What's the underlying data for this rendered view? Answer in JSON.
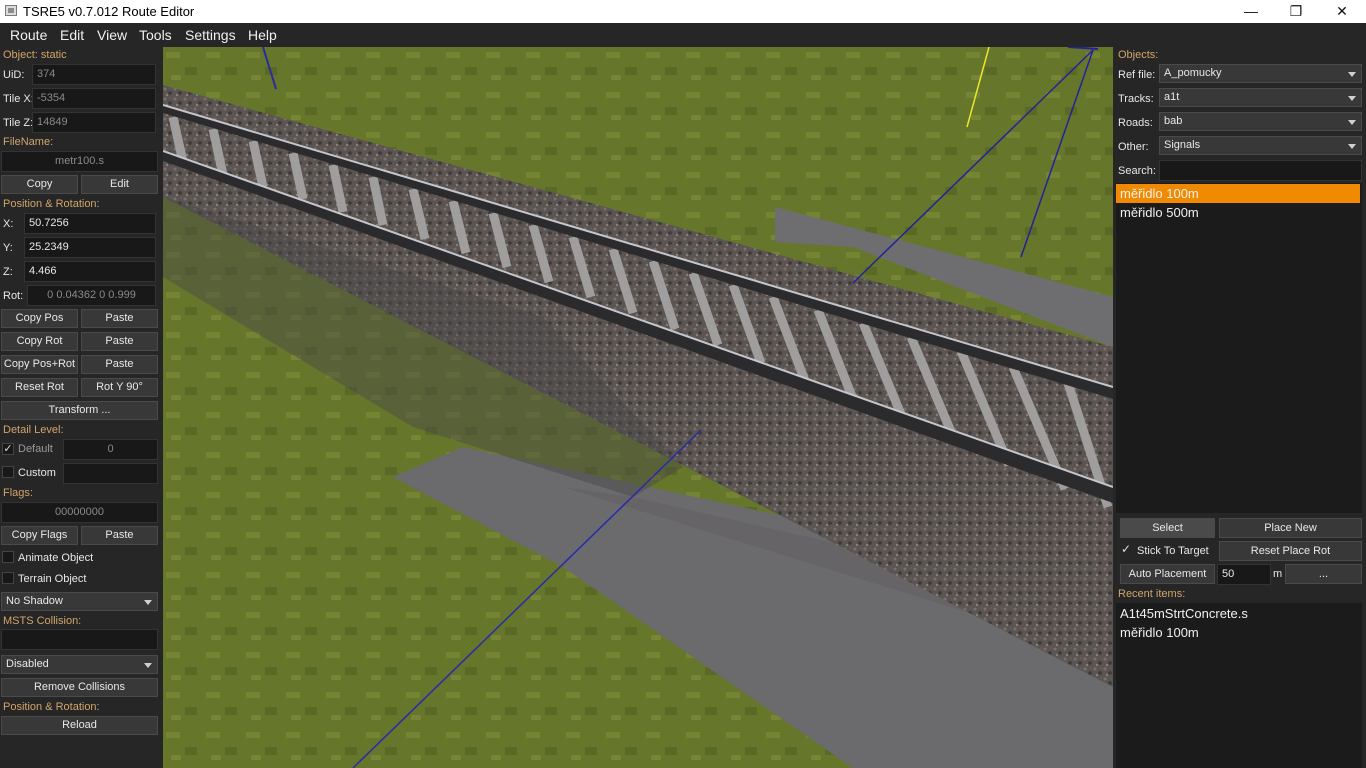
{
  "window": {
    "title": "TSRE5 v0.7.012 Route Editor",
    "minimize": "—",
    "maximize": "❐",
    "close": "✕"
  },
  "menu": [
    "Route",
    "Edit",
    "View",
    "Tools",
    "Settings",
    "Help"
  ],
  "left": {
    "object_label": "Object: static",
    "uid_label": "UiD:",
    "uid": "374",
    "tilex_label": "Tile X:",
    "tilex": "-5354",
    "tilez_label": "Tile Z:",
    "tilez": "14849",
    "filename_label": "FileName:",
    "filename": "metr100.s",
    "copy": "Copy",
    "edit": "Edit",
    "posrot_label": "Position & Rotation:",
    "x_label": "X:",
    "x": "50.7256",
    "y_label": "Y:",
    "y": "25.2349",
    "z_label": "Z:",
    "z": "4.466",
    "rot_label": "Rot:",
    "rot": "0 0.04362 0 0.999",
    "copy_pos": "Copy Pos",
    "paste1": "Paste",
    "copy_rot": "Copy Rot",
    "paste2": "Paste",
    "copy_posrot": "Copy Pos+Rot",
    "paste3": "Paste",
    "reset_rot": "Reset Rot",
    "rot_y90": "Rot Y 90°",
    "transform": "Transform ...",
    "detail_label": "Detail Level:",
    "default_label": "Default",
    "default_check": "✓",
    "detail_value": "0",
    "custom_label": "Custom",
    "flags_label": "Flags:",
    "flags": "00000000",
    "copy_flags": "Copy Flags",
    "paste4": "Paste",
    "animate": "Animate Object",
    "terrain": "Terrain Object",
    "shadow": "No Shadow",
    "msts_label": "MSTS Collision:",
    "collision": "Disabled",
    "remove_collisions": "Remove Collisions",
    "posrot2_label": "Position & Rotation:",
    "reload": "Reload"
  },
  "right": {
    "objects_label": "Objects:",
    "ref_label": "Ref file:",
    "ref": "A_pomucky",
    "tracks_label": "Tracks:",
    "tracks": "a1t",
    "roads_label": "Roads:",
    "roads": "bab",
    "other_label": "Other:",
    "other": "Signals",
    "search_label": "Search:",
    "items": [
      "měřidlo 100m",
      "měřidlo 500m"
    ],
    "select": "Select",
    "place_new": "Place New",
    "stick_check": "✓",
    "stick": "Stick To Target",
    "reset_place_rot": "Reset Place Rot",
    "auto_placement": "Auto Placement",
    "auto_value": "50",
    "auto_unit": "m",
    "more": "...",
    "recent_label": "Recent items:",
    "recent": [
      "A1t45mStrtConcrete.s",
      "měřidlo 100m"
    ],
    "selected_color": "#f08a00",
    "section_color": "#d2a56a"
  }
}
